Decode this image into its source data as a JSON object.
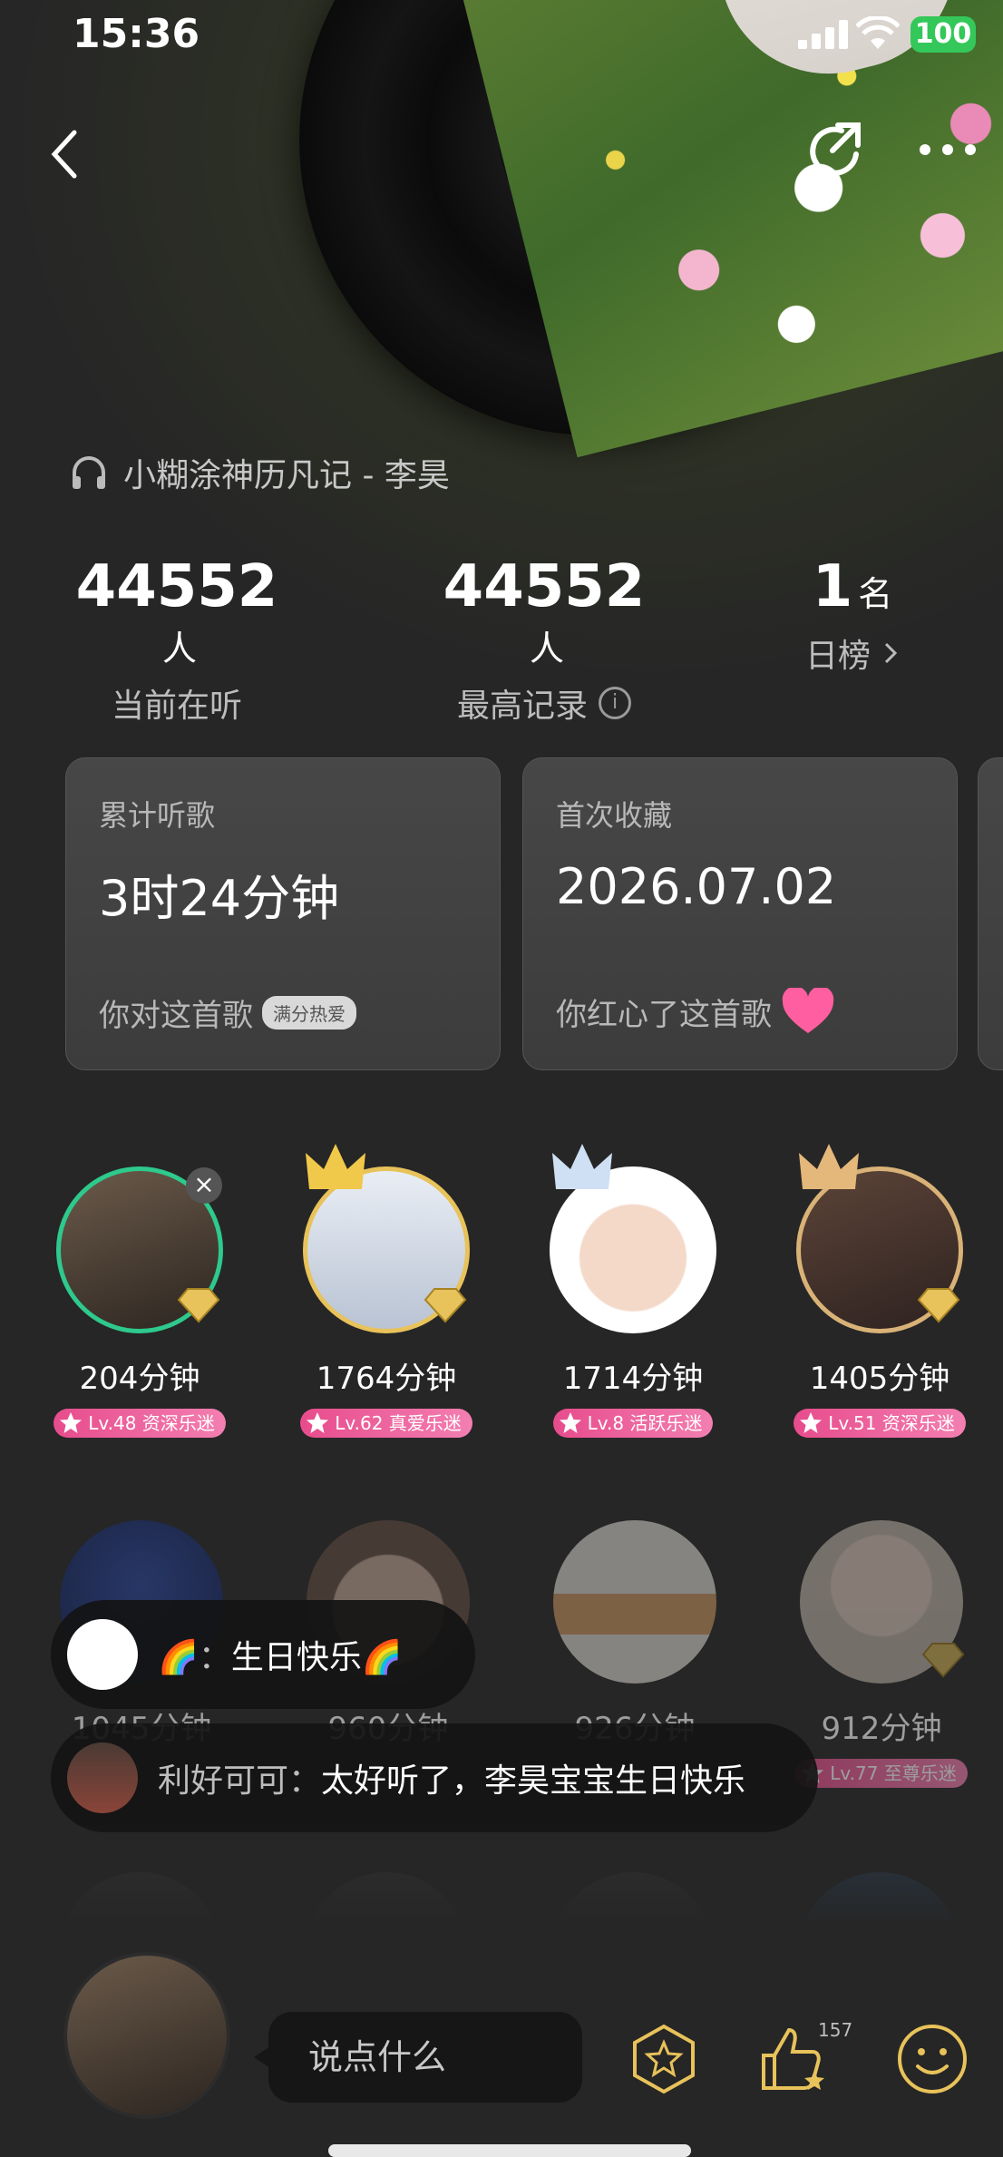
{
  "status_bar": {
    "time": "15:36",
    "battery": "100"
  },
  "song": {
    "title": "小糊涂神历凡记 - 李昊"
  },
  "stats": [
    {
      "value": "44552",
      "unit": "人",
      "label": "当前在听"
    },
    {
      "value": "44552",
      "unit": "人",
      "label": "最高记录"
    },
    {
      "value": "1",
      "unit": "名",
      "label": "日榜"
    }
  ],
  "cards": [
    {
      "title": "累计听歌",
      "value": "3时24分钟",
      "footer": "你对这首歌",
      "badge": "满分热爱"
    },
    {
      "title": "首次收藏",
      "value": "2026.07.02",
      "footer": "你红心了这首歌"
    }
  ],
  "listeners_row1": [
    {
      "minutes": "204分钟",
      "level": "Lv.48 资深乐迷"
    },
    {
      "minutes": "1764分钟",
      "level": "Lv.62 真爱乐迷"
    },
    {
      "minutes": "1714分钟",
      "level": "Lv.8 活跃乐迷"
    },
    {
      "minutes": "1405分钟",
      "level": "Lv.51 资深乐迷"
    }
  ],
  "listeners_row2": [
    {
      "minutes": "1045分钟"
    },
    {
      "minutes": "960分钟"
    },
    {
      "minutes": "926分钟"
    },
    {
      "minutes": "912分钟",
      "level": "Lv.77 至尊乐迷"
    }
  ],
  "comments": [
    {
      "name": "🌈",
      "text": "生日快乐🌈"
    },
    {
      "name": "利好可可",
      "text": "太好听了，李昊宝宝生日快乐"
    }
  ],
  "bottom_bar": {
    "input_placeholder": "说点什么",
    "like_count": "157"
  },
  "colors": {
    "accent_pink": "#e74c8c",
    "online_green": "#2ec98d",
    "gold": "#e8c25a",
    "battery_green": "#34c759"
  }
}
